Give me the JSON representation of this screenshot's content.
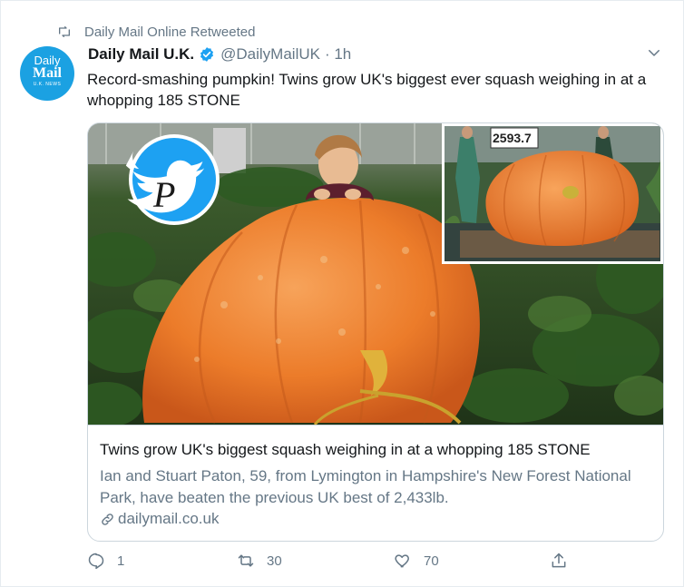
{
  "retweet": {
    "icon": "retweet-icon",
    "text": "Daily Mail Online Retweeted"
  },
  "avatar": {
    "line1": "Daily",
    "line2": "Mail",
    "line3": "U.K. NEWS"
  },
  "author": {
    "name": "Daily Mail U.K.",
    "verified": true,
    "handle": "@DailyMailUK",
    "time": "· 1h"
  },
  "tweet": {
    "text": "Record-smashing pumpkin! Twins grow UK's biggest ever squash weighing in at a whopping 185 STONE"
  },
  "card": {
    "inset_sign": "2593.7",
    "title": "Twins grow UK's biggest squash weighing in at a whopping 185 STONE",
    "description": "Ian and Stuart Paton, 59, from Lymington in Hampshire's New Forest National Park, have beaten the previous UK best of 2,433lb.",
    "domain": "dailymail.co.uk"
  },
  "actions": {
    "reply": "1",
    "retweet": "30",
    "like": "70"
  },
  "colors": {
    "accent": "#1da1f2",
    "muted": "#657786",
    "border": "#ccd6dd",
    "pumpkin": "#f0842d"
  }
}
